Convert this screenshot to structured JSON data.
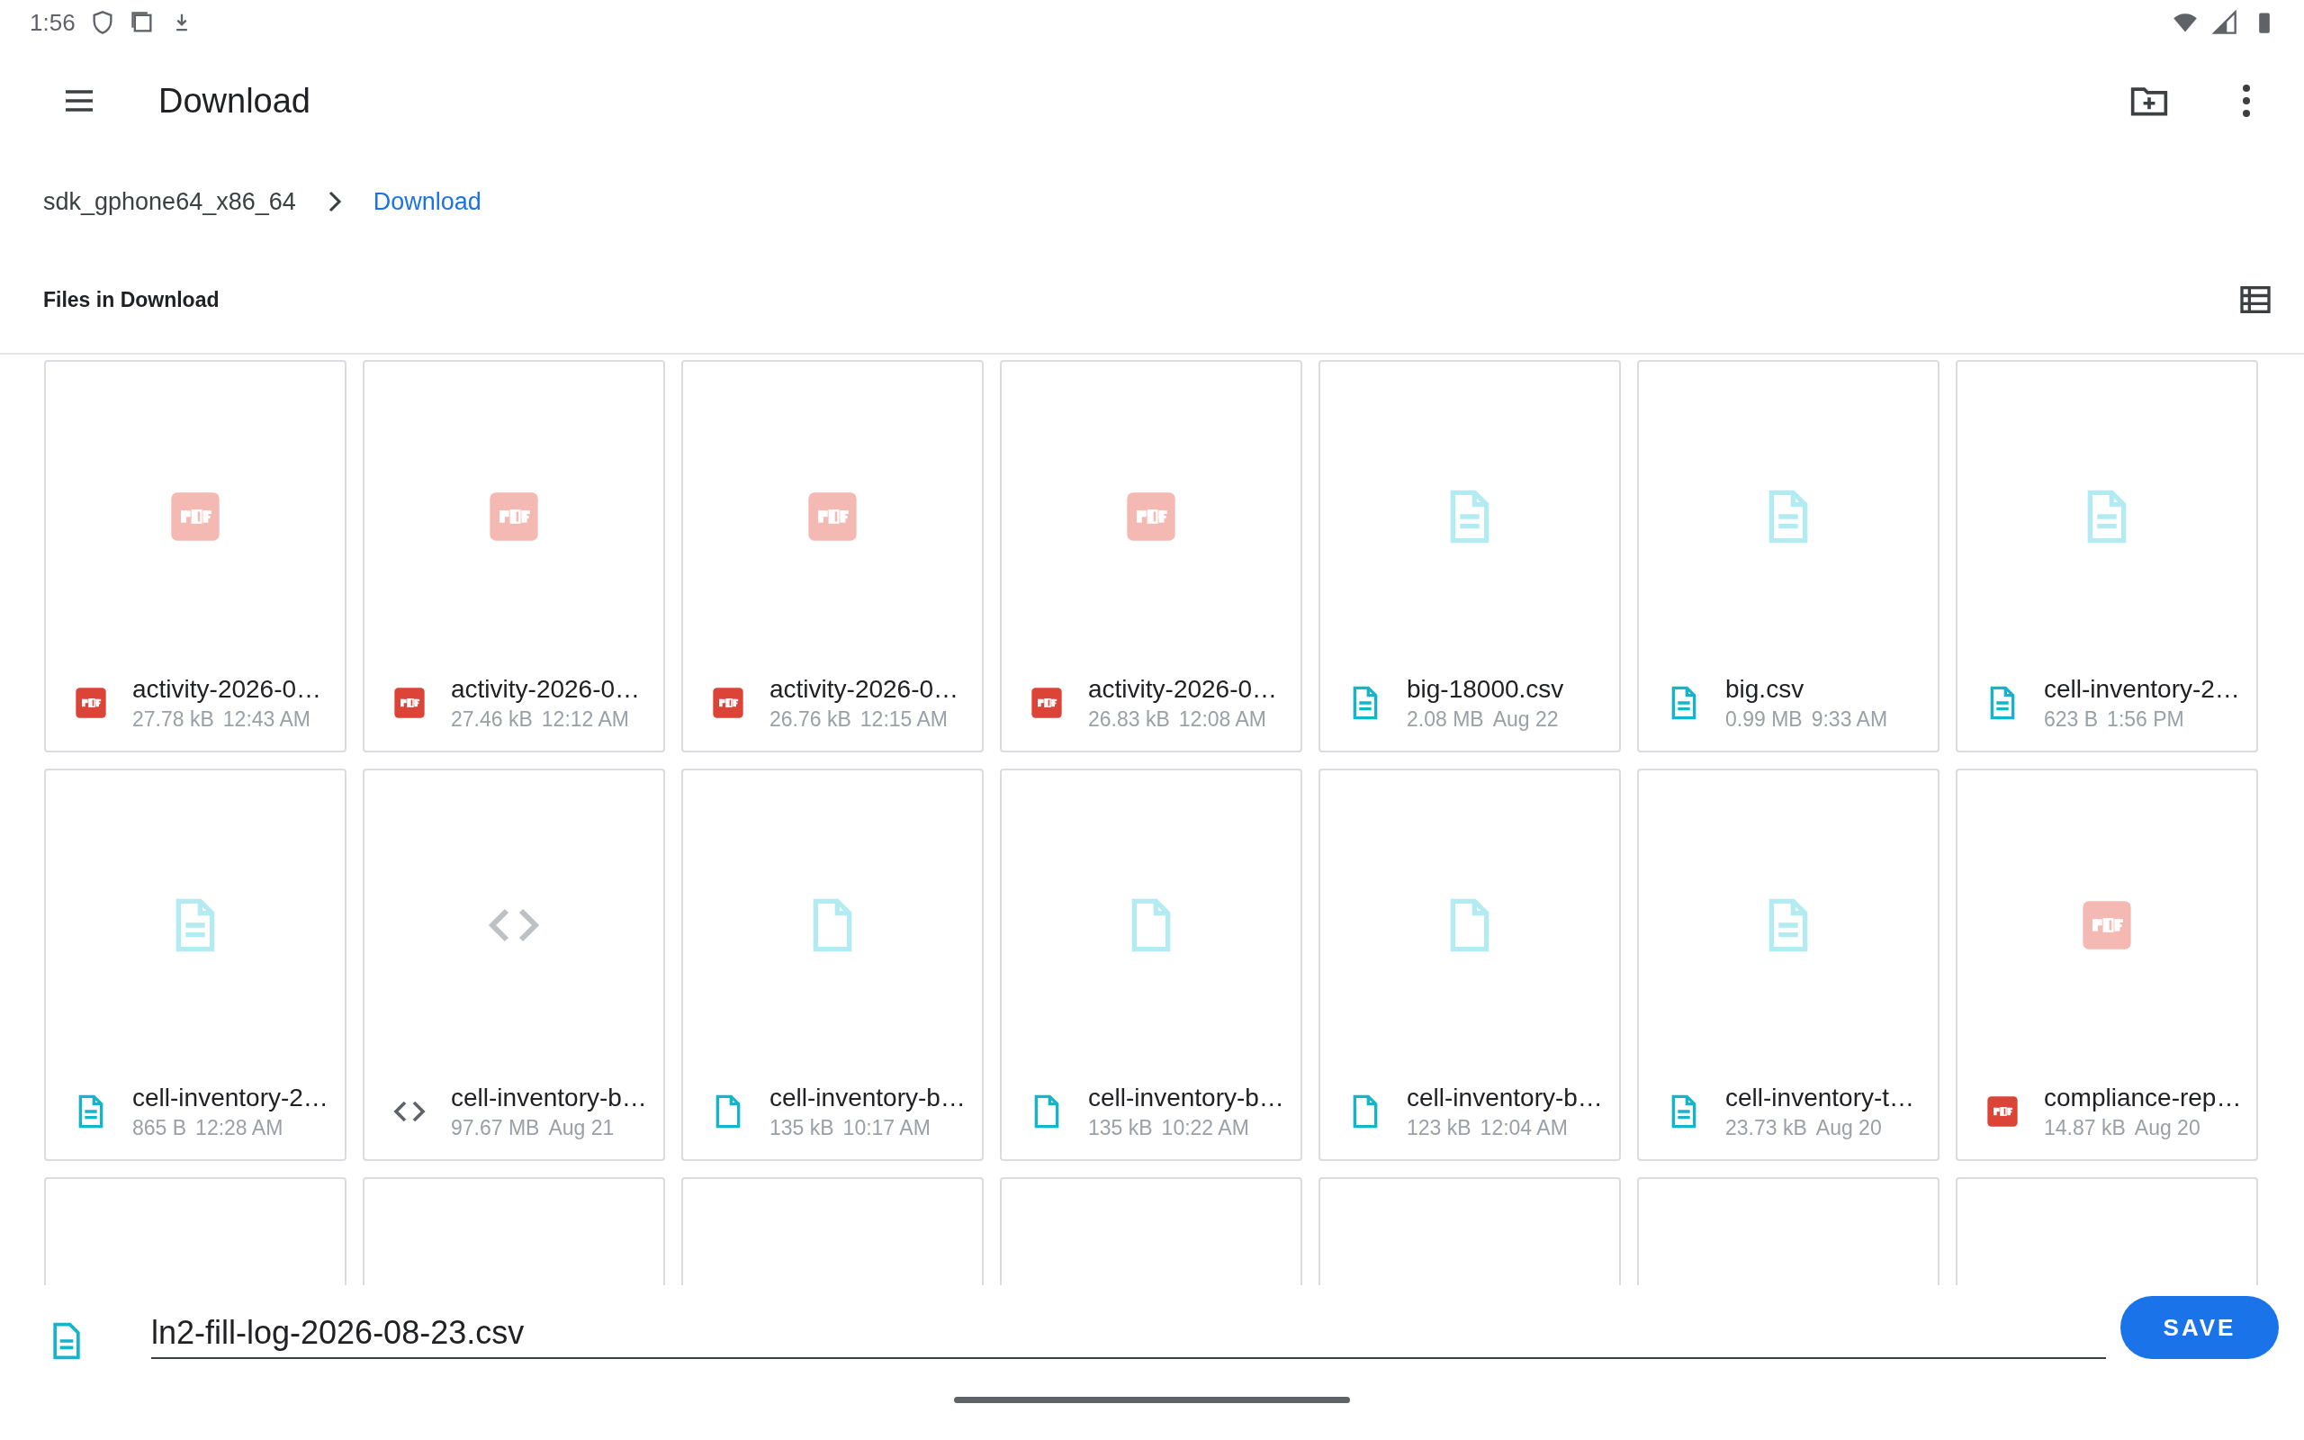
{
  "status_bar": {
    "time": "1:56"
  },
  "toolbar": {
    "title": "Download"
  },
  "breadcrumb": [
    {
      "label": "sdk_gphone64_x86_64",
      "selected": false
    },
    {
      "label": "Download",
      "selected": true
    }
  ],
  "section": {
    "title": "Files in Download"
  },
  "files": [
    {
      "kind": "pdf",
      "name": "activity-2026-0…",
      "size": "27.78 kB",
      "date": "12:43 AM"
    },
    {
      "kind": "pdf",
      "name": "activity-2026-0…",
      "size": "27.46 kB",
      "date": "12:12 AM"
    },
    {
      "kind": "pdf",
      "name": "activity-2026-0…",
      "size": "26.76 kB",
      "date": "12:15 AM"
    },
    {
      "kind": "pdf",
      "name": "activity-2026-0…",
      "size": "26.83 kB",
      "date": "12:08 AM"
    },
    {
      "kind": "doc",
      "name": "big-18000.csv",
      "size": "2.08 MB",
      "date": "Aug 22"
    },
    {
      "kind": "doc",
      "name": "big.csv",
      "size": "0.99 MB",
      "date": "9:33 AM"
    },
    {
      "kind": "doc",
      "name": "cell-inventory-2…",
      "size": "623 B",
      "date": "1:56 PM"
    },
    {
      "kind": "doc",
      "name": "cell-inventory-2…",
      "size": "865 B",
      "date": "12:28 AM"
    },
    {
      "kind": "code",
      "name": "cell-inventory-b…",
      "size": "97.67 MB",
      "date": "Aug 21"
    },
    {
      "kind": "blank",
      "name": "cell-inventory-b…",
      "size": "135 kB",
      "date": "10:17 AM"
    },
    {
      "kind": "blank",
      "name": "cell-inventory-b…",
      "size": "135 kB",
      "date": "10:22 AM"
    },
    {
      "kind": "blank",
      "name": "cell-inventory-b…",
      "size": "123 kB",
      "date": "12:04 AM"
    },
    {
      "kind": "doc",
      "name": "cell-inventory-t…",
      "size": "23.73 kB",
      "date": "Aug 20"
    },
    {
      "kind": "pdf",
      "name": "compliance-rep…",
      "size": "14.87 kB",
      "date": "Aug 20"
    },
    {
      "kind": "cut"
    },
    {
      "kind": "cut"
    },
    {
      "kind": "cut"
    },
    {
      "kind": "cut"
    },
    {
      "kind": "cut"
    },
    {
      "kind": "cut"
    },
    {
      "kind": "cut"
    }
  ],
  "save_bar": {
    "file_name": "ln2-fill-log-2026-08-23.csv",
    "button": "SAVE"
  }
}
